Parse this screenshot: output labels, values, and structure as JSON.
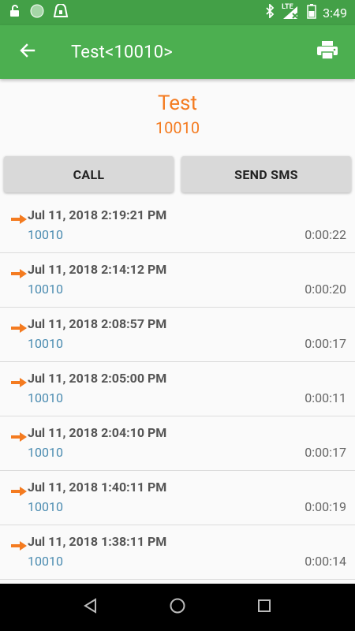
{
  "status_bar": {
    "time": "3:49",
    "network": "LTE",
    "icons": [
      "unlock-icon",
      "circle-icon",
      "alert-icon",
      "bluetooth-icon",
      "signal-icon",
      "battery-icon"
    ]
  },
  "app_bar": {
    "title": "Test<10010>",
    "back_icon": "arrow-back-icon",
    "print_icon": "print-icon"
  },
  "contact": {
    "name": "Test",
    "number": "10010"
  },
  "actions": {
    "call_label": "CALL",
    "sms_label": "SEND SMS"
  },
  "colors": {
    "status_bar": "#43a047",
    "app_bar": "#4caf50",
    "accent_orange": "#f47b20",
    "number_blue": "#4a8bb0"
  },
  "calls": [
    {
      "date": "Jul 11, 2018 2:19:21 PM",
      "number": "10010",
      "duration": "0:00:22",
      "direction": "outgoing"
    },
    {
      "date": "Jul 11, 2018 2:14:12 PM",
      "number": "10010",
      "duration": "0:00:20",
      "direction": "outgoing"
    },
    {
      "date": "Jul 11, 2018 2:08:57 PM",
      "number": "10010",
      "duration": "0:00:17",
      "direction": "outgoing"
    },
    {
      "date": "Jul 11, 2018 2:05:00 PM",
      "number": "10010",
      "duration": "0:00:11",
      "direction": "outgoing"
    },
    {
      "date": "Jul 11, 2018 2:04:10 PM",
      "number": "10010",
      "duration": "0:00:17",
      "direction": "outgoing"
    },
    {
      "date": "Jul 11, 2018 1:40:11 PM",
      "number": "10010",
      "duration": "0:00:19",
      "direction": "outgoing"
    },
    {
      "date": "Jul 11, 2018 1:38:11 PM",
      "number": "10010",
      "duration": "0:00:14",
      "direction": "outgoing"
    }
  ],
  "nav_bar": {
    "icons": [
      "back-triangle-icon",
      "home-circle-icon",
      "recents-square-icon"
    ]
  }
}
